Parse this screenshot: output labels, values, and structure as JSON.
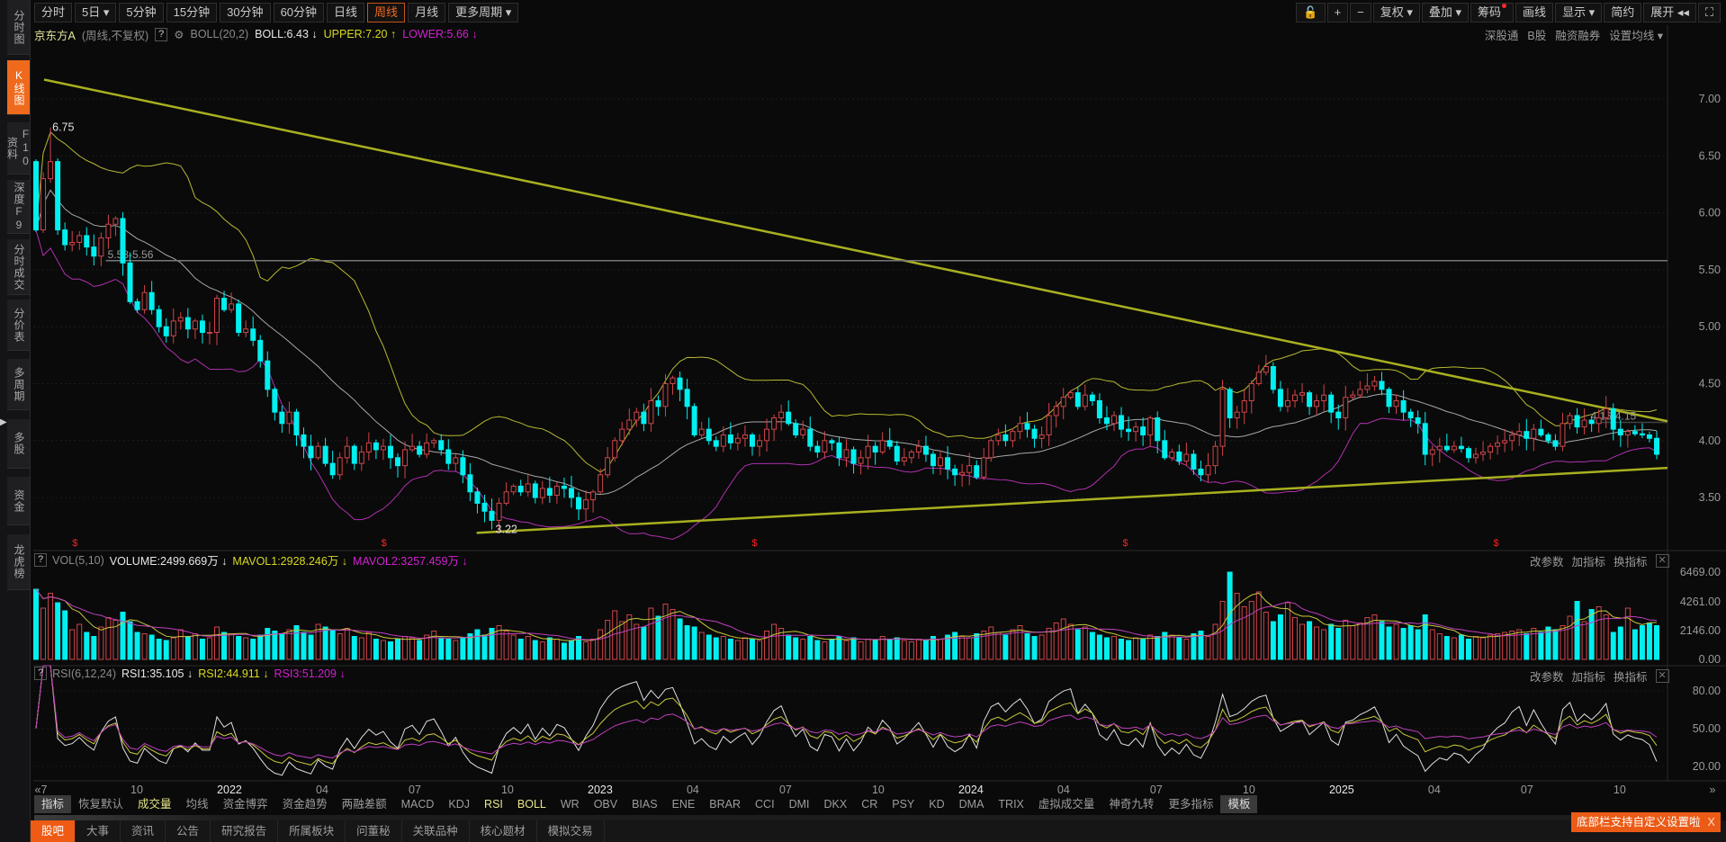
{
  "sidebar": {
    "items": [
      {
        "label": "分时图",
        "active": false
      },
      {
        "label": "K线图",
        "active": true
      },
      {
        "label": "F10资料",
        "active": false
      },
      {
        "label": "深度F9",
        "active": false
      },
      {
        "label": "分时成交",
        "active": false
      },
      {
        "label": "分价表",
        "active": false
      },
      {
        "label": "多周期",
        "active": false
      },
      {
        "label": "多股",
        "active": false
      },
      {
        "label": "资金",
        "active": false
      },
      {
        "label": "龙虎榜",
        "active": false
      }
    ],
    "expand_icon": "chevron-right-icon"
  },
  "toolbar": {
    "periods": [
      {
        "label": "分时"
      },
      {
        "label": "5日 ▾"
      },
      {
        "label": "5分钟"
      },
      {
        "label": "15分钟"
      },
      {
        "label": "30分钟"
      },
      {
        "label": "60分钟"
      },
      {
        "label": "日线"
      },
      {
        "label": "周线",
        "active": true
      },
      {
        "label": "月线"
      },
      {
        "label": "更多周期 ▾"
      }
    ],
    "right": {
      "lock": "🔓",
      "zoom_in": "+",
      "zoom_out": "−",
      "fuquan": "复权 ▾",
      "overlay": "叠加 ▾",
      "chips": "筹码",
      "draw": "画线",
      "display": "显示 ▾",
      "simple": "简约",
      "expand": "展开 ◂◂",
      "collapse": "⛶"
    }
  },
  "info": {
    "stock_name": "京东方A",
    "mode": "(周线,不复权)",
    "help": "?",
    "indicator": "BOLL(20,2)",
    "boll": "BOLL:6.43 ↓",
    "upper": "UPPER:7.20 ↑",
    "lower": "LOWER:5.66 ↓",
    "right_links": [
      "深股通",
      "B股",
      "融资融券",
      "设置均线 ▾"
    ]
  },
  "volume_pane": {
    "help": "?",
    "name": "VOL(5,10)",
    "volume": "VOLUME:2499.669万 ↓",
    "mavol1": "MAVOL1:2928.246万 ↓",
    "mavol2": "MAVOL2:3257.459万 ↓",
    "actions": [
      "改参数",
      "加指标",
      "换指标"
    ],
    "close": "✕"
  },
  "rsi_pane": {
    "help": "?",
    "name": "RSI(6,12,24)",
    "rsi1": "RSI1:35.105 ↓",
    "rsi2": "RSI2:44.911 ↓",
    "rsi3": "RSI3:51.209 ↓",
    "actions": [
      "改参数",
      "加指标",
      "换指标"
    ],
    "close": "✕"
  },
  "indicator_tabs": [
    {
      "label": "指标",
      "style": "box"
    },
    {
      "label": "恢复默认"
    },
    {
      "label": "成交量",
      "style": "hl"
    },
    {
      "label": "均线"
    },
    {
      "label": "资金博弈"
    },
    {
      "label": "资金趋势"
    },
    {
      "label": "两融差额"
    },
    {
      "label": "MACD"
    },
    {
      "label": "KDJ"
    },
    {
      "label": "RSI",
      "style": "hl"
    },
    {
      "label": "BOLL",
      "style": "hl"
    },
    {
      "label": "WR"
    },
    {
      "label": "OBV"
    },
    {
      "label": "BIAS"
    },
    {
      "label": "ENE"
    },
    {
      "label": "BRAR"
    },
    {
      "label": "CCI"
    },
    {
      "label": "DMI"
    },
    {
      "label": "DKX"
    },
    {
      "label": "CR"
    },
    {
      "label": "PSY"
    },
    {
      "label": "KD"
    },
    {
      "label": "DMA"
    },
    {
      "label": "TRIX"
    },
    {
      "label": "虚拟成交量"
    },
    {
      "label": "神奇九转"
    },
    {
      "label": "更多指标"
    },
    {
      "label": "模板",
      "style": "box"
    }
  ],
  "bottom_tabs": [
    {
      "label": "股吧",
      "active": true
    },
    {
      "label": "大事"
    },
    {
      "label": "资讯"
    },
    {
      "label": "公告"
    },
    {
      "label": "研究报告"
    },
    {
      "label": "所属板块"
    },
    {
      "label": "问董秘"
    },
    {
      "label": "关联品种"
    },
    {
      "label": "核心题材"
    },
    {
      "label": "模拟交易"
    }
  ],
  "tooltip": {
    "text": "底部栏支持自定义设置啦",
    "close": "X"
  },
  "nav": {
    "left": "«",
    "right": "»"
  },
  "colors": {
    "up": "#d0454a",
    "down": "#00f0f0",
    "boll_mid": "#cfcfcf",
    "boll_upper": "#b8b832",
    "boll_lower": "#b030b0",
    "trend": "#a8b020",
    "mavol1": "#c8c83a",
    "mavol2": "#c040c0",
    "rsi1": "#e0e0e0",
    "rsi2": "#c8c83a",
    "rsi3": "#c040c0",
    "accent": "#ef6a1c"
  },
  "chart_data": {
    "type": "candlestick",
    "interval": "weekly",
    "xlim": [
      "2021-07",
      "2025-11"
    ],
    "x_ticks": [
      {
        "date": "2021-07",
        "label": "7"
      },
      {
        "date": "2021-10",
        "label": "10"
      },
      {
        "date": "2022-01",
        "label": "2022",
        "year": true
      },
      {
        "date": "2022-04",
        "label": "04"
      },
      {
        "date": "2022-07",
        "label": "07"
      },
      {
        "date": "2022-10",
        "label": "10"
      },
      {
        "date": "2023-01",
        "label": "2023",
        "year": true
      },
      {
        "date": "2023-04",
        "label": "04"
      },
      {
        "date": "2023-07",
        "label": "07"
      },
      {
        "date": "2023-10",
        "label": "10"
      },
      {
        "date": "2024-01",
        "label": "2024",
        "year": true
      },
      {
        "date": "2024-04",
        "label": "04"
      },
      {
        "date": "2024-07",
        "label": "07"
      },
      {
        "date": "2024-10",
        "label": "10"
      },
      {
        "date": "2025-01",
        "label": "2025",
        "year": true
      },
      {
        "date": "2025-04",
        "label": "04"
      },
      {
        "date": "2025-07",
        "label": "07"
      },
      {
        "date": "2025-10",
        "label": "10"
      }
    ],
    "price_axis": {
      "ticks": [
        "7.00",
        "6.50",
        "6.00",
        "5.50",
        "5.00",
        "4.50",
        "4.00",
        "3.50"
      ],
      "ylim": [
        3.1,
        7.3
      ]
    },
    "candles": {
      "close": [
        5.85,
        6.3,
        6.45,
        5.85,
        5.72,
        5.74,
        5.8,
        5.7,
        5.62,
        5.78,
        5.9,
        5.95,
        5.56,
        5.22,
        5.15,
        5.3,
        5.15,
        5.0,
        4.92,
        5.05,
        5.08,
        4.98,
        5.05,
        4.95,
        4.95,
        5.25,
        5.15,
        5.2,
        4.95,
        4.98,
        4.88,
        4.7,
        4.45,
        4.25,
        4.15,
        4.25,
        4.05,
        3.95,
        3.85,
        3.95,
        3.8,
        3.7,
        3.85,
        3.95,
        3.8,
        3.9,
        3.98,
        3.92,
        3.95,
        3.85,
        3.78,
        3.92,
        3.95,
        3.88,
        3.98,
        4.0,
        3.92,
        3.8,
        3.85,
        3.7,
        3.55,
        3.45,
        3.38,
        3.3,
        3.45,
        3.55,
        3.6,
        3.55,
        3.62,
        3.5,
        3.58,
        3.52,
        3.6,
        3.58,
        3.5,
        3.4,
        3.48,
        3.55,
        3.7,
        3.85,
        4.0,
        4.1,
        4.18,
        4.25,
        4.15,
        4.35,
        4.3,
        4.5,
        4.55,
        4.45,
        4.3,
        4.05,
        4.1,
        4.0,
        3.95,
        4.05,
        3.98,
        4.02,
        4.05,
        3.95,
        4.0,
        4.1,
        4.2,
        4.25,
        4.15,
        4.05,
        4.1,
        3.95,
        3.9,
        4.0,
        3.98,
        3.85,
        3.92,
        3.8,
        3.85,
        3.95,
        3.9,
        4.0,
        3.95,
        3.82,
        3.85,
        3.9,
        3.95,
        3.88,
        3.78,
        3.85,
        3.75,
        3.7,
        3.72,
        3.78,
        3.68,
        3.85,
        4.0,
        4.05,
        4.0,
        4.08,
        4.15,
        4.1,
        4.02,
        4.05,
        4.22,
        4.3,
        4.38,
        4.42,
        4.3,
        4.4,
        4.35,
        4.2,
        4.15,
        4.22,
        4.1,
        4.08,
        4.12,
        4.05,
        4.2,
        4.0,
        3.85,
        3.9,
        3.82,
        3.88,
        3.75,
        3.7,
        3.78,
        3.95,
        4.45,
        4.2,
        4.25,
        4.35,
        4.5,
        4.6,
        4.65,
        4.45,
        4.3,
        4.35,
        4.4,
        4.42,
        4.3,
        4.35,
        4.4,
        4.25,
        4.2,
        4.38,
        4.4,
        4.45,
        4.48,
        4.52,
        4.45,
        4.3,
        4.35,
        4.25,
        4.2,
        4.15,
        3.88,
        3.92,
        3.95,
        3.92,
        3.95,
        3.93,
        3.85,
        3.88,
        3.9,
        3.95,
        3.98,
        4.0,
        4.05,
        4.08,
        4.02,
        4.1,
        4.05,
        4.0,
        3.95,
        4.15,
        4.22,
        4.12,
        4.18,
        4.15,
        4.2,
        4.28,
        4.1,
        4.05,
        4.08,
        4.06,
        4.05,
        4.02,
        3.88
      ]
    },
    "annotations": {
      "high": {
        "label": "6.75",
        "value": 6.75
      },
      "low": {
        "label": "3.22",
        "value": 3.22
      },
      "gap_lines": [
        {
          "label": "5.58-5.56",
          "price": 5.58,
          "from": "2021-09"
        },
        {
          "label": "4.16-4.15",
          "price": 4.16,
          "from": "2025-09"
        }
      ],
      "trend_lines": [
        {
          "from": {
            "date": "2021-07",
            "price": 7.17
          },
          "to": {
            "date": "2025-11",
            "price": 4.17
          }
        },
        {
          "from": {
            "date": "2022-09",
            "price": 3.19
          },
          "to": {
            "date": "2025-11",
            "price": 3.76
          }
        }
      ],
      "dividend_markers": [
        {
          "date": "2021-08",
          "label": "$"
        },
        {
          "date": "2022-06",
          "label": "$"
        },
        {
          "date": "2023-06",
          "label": "$"
        },
        {
          "date": "2024-06",
          "label": "$"
        },
        {
          "date": "2025-06",
          "label": "$"
        }
      ]
    },
    "indicators": {
      "boll": {
        "period": 20,
        "k": 2
      },
      "mavol": [
        5,
        10
      ],
      "rsi": [
        6,
        12,
        24
      ]
    },
    "volume": {
      "unit": "万",
      "ticks": [
        "6469.00",
        "4261.00",
        "2146.00",
        "0.00"
      ],
      "ylim": [
        0,
        6469
      ],
      "values": [
        5200,
        3800,
        4900,
        4200,
        3600,
        2200,
        2600,
        2000,
        1700,
        2400,
        3100,
        2900,
        3500,
        2800,
        2000,
        1900,
        1800,
        1500,
        1400,
        1600,
        2200,
        1700,
        1900,
        1500,
        1600,
        2400,
        2000,
        1900,
        1700,
        1600,
        1500,
        1800,
        2300,
        2100,
        1900,
        2200,
        2500,
        2000,
        1800,
        2600,
        2400,
        2200,
        1900,
        2300,
        1700,
        1600,
        2000,
        1500,
        1400,
        1300,
        1500,
        1700,
        1600,
        1400,
        1800,
        2100,
        1600,
        1500,
        1400,
        1600,
        1900,
        2200,
        1800,
        2300,
        2500,
        2100,
        1800,
        1500,
        1700,
        1400,
        1300,
        1600,
        1500,
        1200,
        1400,
        1700,
        1300,
        1500,
        2200,
        2900,
        3600,
        2800,
        3300,
        2600,
        2400,
        3800,
        3200,
        4100,
        3700,
        3000,
        2500,
        2400,
        2000,
        1800,
        1600,
        1700,
        1500,
        1400,
        1600,
        1500,
        1400,
        2100,
        2600,
        2300,
        1800,
        1600,
        1500,
        1700,
        1400,
        1300,
        1500,
        1700,
        1400,
        1600,
        1300,
        1500,
        1400,
        1700,
        1500,
        1600,
        1400,
        1300,
        1500,
        1400,
        1700,
        1500,
        1800,
        2000,
        1700,
        1600,
        1900,
        2100,
        2400,
        2000,
        1800,
        2200,
        2500,
        1900,
        1700,
        1800,
        2300,
        2700,
        3000,
        2600,
        2200,
        2400,
        2000,
        1800,
        1600,
        1700,
        1500,
        1400,
        1600,
        1500,
        1800,
        1700,
        2000,
        1800,
        1600,
        1500,
        1900,
        2100,
        1700,
        2600,
        4300,
        6469,
        4900,
        3900,
        4300,
        5000,
        3500,
        2800,
        3300,
        4200,
        3100,
        2600,
        2800,
        2400,
        2200,
        2600,
        2300,
        2900,
        2500,
        2700,
        3100,
        3300,
        2800,
        2400,
        2600,
        2300,
        2500,
        2200,
        3300,
        2200,
        1900,
        1700,
        1600,
        1800,
        1500,
        1700,
        1600,
        1800,
        1900,
        2000,
        2100,
        2200,
        1900,
        2300,
        2000,
        2400,
        2200,
        2500,
        3200,
        4300,
        2800,
        3700,
        3900,
        3300,
        2000,
        2400,
        3800,
        2200,
        2500,
        2700,
        2500
      ]
    },
    "rsi_axis": {
      "ticks": [
        "80.00",
        "50.00",
        "20.00"
      ],
      "ylim": [
        0,
        100
      ]
    }
  }
}
